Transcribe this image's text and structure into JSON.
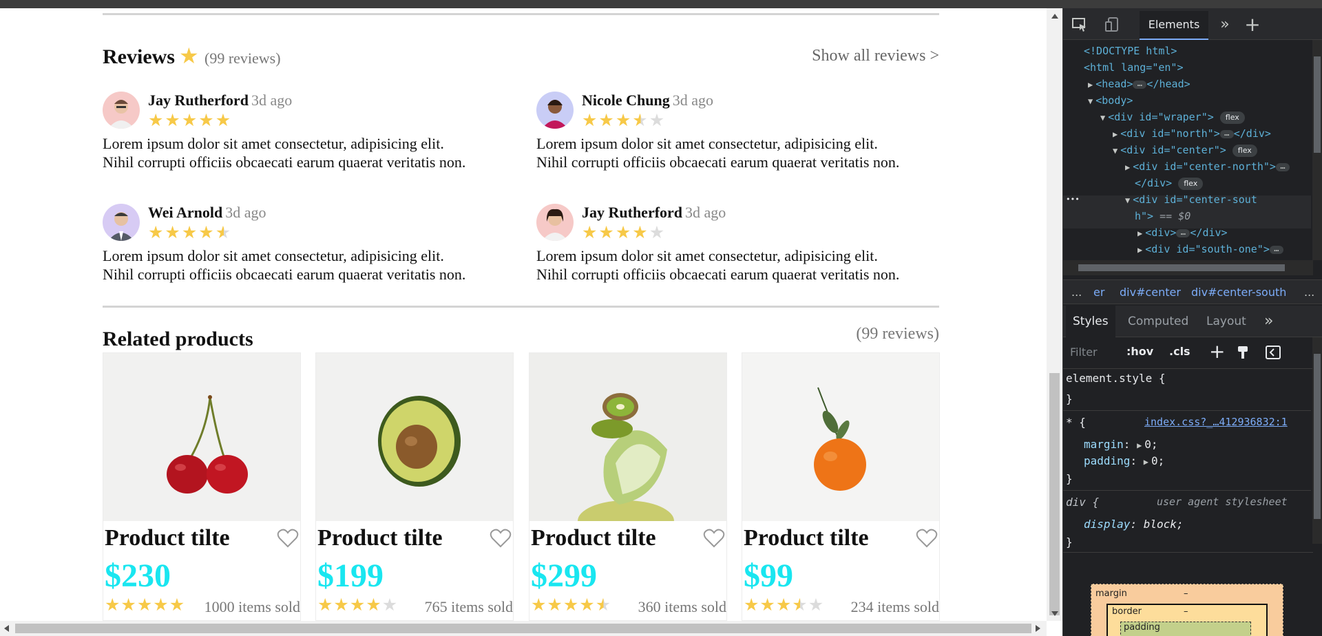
{
  "reviews_section": {
    "title": "Reviews",
    "count_label": "(99 reviews)",
    "show_all": "Show all reviews >",
    "items": [
      {
        "name": "Jay Rutherford",
        "time": "3d ago",
        "rating": 5,
        "text_line1": "Lorem ipsum dolor sit amet consectetur, adipisicing elit.",
        "text_line2": "Nihil corrupti officiis obcaecati earum quaerat veritatis non.",
        "avatar_color": "#f6c9c7"
      },
      {
        "name": "Nicole Chung",
        "time": "3d ago",
        "rating": 3.5,
        "text_line1": "Lorem ipsum dolor sit amet consectetur, adipisicing elit.",
        "text_line2": "Nihil corrupti officiis obcaecati earum quaerat veritatis non.",
        "avatar_color": "#c9cdf6"
      },
      {
        "name": "Wei Arnold",
        "time": "3d ago",
        "rating": 4.5,
        "text_line1": "Lorem ipsum dolor sit amet consectetur, adipisicing elit.",
        "text_line2": "Nihil corrupti officiis obcaecati earum quaerat veritatis non.",
        "avatar_color": "#d7cbf4"
      },
      {
        "name": "Jay Rutherford",
        "time": "3d ago",
        "rating": 4,
        "text_line1": "Lorem ipsum dolor sit amet consectetur, adipisicing elit.",
        "text_line2": "Nihil corrupti officiis obcaecati earum quaerat veritatis non.",
        "avatar_color": "#f6c9c7"
      }
    ]
  },
  "related_section": {
    "title": "Related products",
    "count_label": "(99 reviews)",
    "products": [
      {
        "title": "Product tilte",
        "price": "$230",
        "rating": 5,
        "sold": "1000 items sold",
        "image": "cherries"
      },
      {
        "title": "Product tilte",
        "price": "$199",
        "rating": 4,
        "sold": "765 items sold",
        "image": "avocado"
      },
      {
        "title": "Product tilte",
        "price": "$299",
        "rating": 4.5,
        "sold": "360 items sold",
        "image": "kiwi-lime"
      },
      {
        "title": "Product tilte",
        "price": "$99",
        "rating": 3.5,
        "sold": "234 items sold",
        "image": "tangerine"
      }
    ]
  },
  "colors": {
    "price": "#19e6f0",
    "star": "#f7c948",
    "star_empty": "#dcdcdc",
    "devtools_bg": "#202124"
  },
  "devtools": {
    "active_tab": "Elements",
    "dom": {
      "doctype": "<!DOCTYPE html>",
      "html_open": "<html lang=\"en\">",
      "head": "<head>",
      "head_close": "</head>",
      "body": "<body>",
      "wraper": "<div id=\"wraper\">",
      "north": "<div id=\"north\">",
      "div_close": "</div>",
      "center": "<div id=\"center\">",
      "center_north": "<div id=\"center-north\">",
      "center_south_a": "<div id=\"center-sout",
      "center_south_b": "h\">",
      "selected_marker": "== $0",
      "inner_div": "<div>",
      "south_one": "<div id=\"south-one\">",
      "flex_pill": "flex",
      "gutter_dots": "•••"
    },
    "breadcrumbs": [
      "...",
      "er",
      "div#center",
      "div#center-south",
      "..."
    ],
    "styles_tabs": [
      "Styles",
      "Computed",
      "Layout"
    ],
    "filter_placeholder": "Filter",
    "hov": ":hov",
    "cls": ".cls",
    "rules": {
      "element_style": "element.style {",
      "close": "}",
      "star_selector": "* {",
      "star_source": "index.css?_…412936832:1",
      "margin": "margin",
      "margin_val": "0;",
      "padding": "padding",
      "padding_val": "0;",
      "div_selector": "div {",
      "ua": "user agent stylesheet",
      "display": "display",
      "display_val": "block;"
    },
    "boxmodel": {
      "margin": "margin",
      "border": "border",
      "padding": "padding",
      "dash": "–"
    }
  }
}
